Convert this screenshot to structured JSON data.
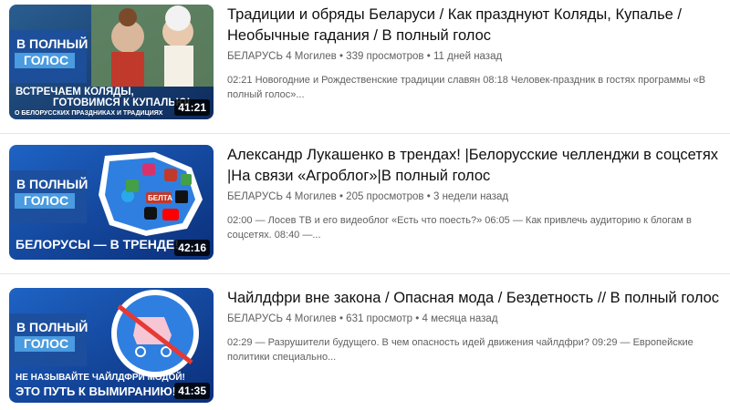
{
  "videos": [
    {
      "title": "Традиции и обряды Беларуси / Как празднуют Коляды, Купалье / Необычные гадания / В полный голос",
      "channel": "БЕЛАРУСЬ 4 Могилев",
      "views": "339 просмотров",
      "age": "11 дней назад",
      "description": "02:21 Новогодние и Рождественские традиции славян 08:18 Человек-праздник в гостях программы «В полный голос»...",
      "duration": "41:21",
      "thumb": {
        "show_name_1": "В ПОЛНЫЙ",
        "show_name_2": "ГОЛОС",
        "line1": "ВСТРЕЧАЕМ КОЛЯДЫ,",
        "line2": "ГОТОВИМСЯ К КУПАЛЬЮ!",
        "line3": "О БЕЛОРУССКИХ ПРАЗДНИКАХ И ТРАДИЦИЯХ"
      }
    },
    {
      "title": "Александр Лукашенко в трендах! |Белорусские челленджи в соцсетях |На связи «Агроблог»|В полный голос",
      "channel": "БЕЛАРУСЬ 4 Могилев",
      "views": "205 просмотров",
      "age": "3 недели назад",
      "description": "02:00 — Лосев ТВ и его видеоблог «Есть что поесть?» 06:05 — Как привлечь аудиторию к блогам в соцсетях. 08:40 —...",
      "duration": "42:16",
      "thumb": {
        "show_name_1": "В ПОЛНЫЙ",
        "show_name_2": "ГОЛОС",
        "line1": "БЕЛОРУСЫ — В ТРЕНДЕ!",
        "badge": "БЕЛТА"
      }
    },
    {
      "title": "Чайлдфри вне закона / Опасная мода / Бездетность // В полный голос",
      "channel": "БЕЛАРУСЬ 4 Могилев",
      "views": "631 просмотр",
      "age": "4 месяца назад",
      "description": "02:29 — Разрушители будущего. В чем опасность идей движения чайлдфри? 09:29 — Европейские политики специально...",
      "duration": "41:35",
      "thumb": {
        "show_name_1": "В ПОЛНЫЙ",
        "show_name_2": "ГОЛОС",
        "line1": "НЕ НАЗЫВАЙТЕ ЧАЙЛДФРИ МОДОЙ!",
        "line2": "ЭТО ПУТЬ К ВЫМИРАНИЮ!"
      }
    }
  ],
  "colors": {
    "title": "#0f0f0f",
    "meta": "#606060",
    "thumb_blue": "#1565c0",
    "thumb_dark": "#0d2a6b"
  }
}
